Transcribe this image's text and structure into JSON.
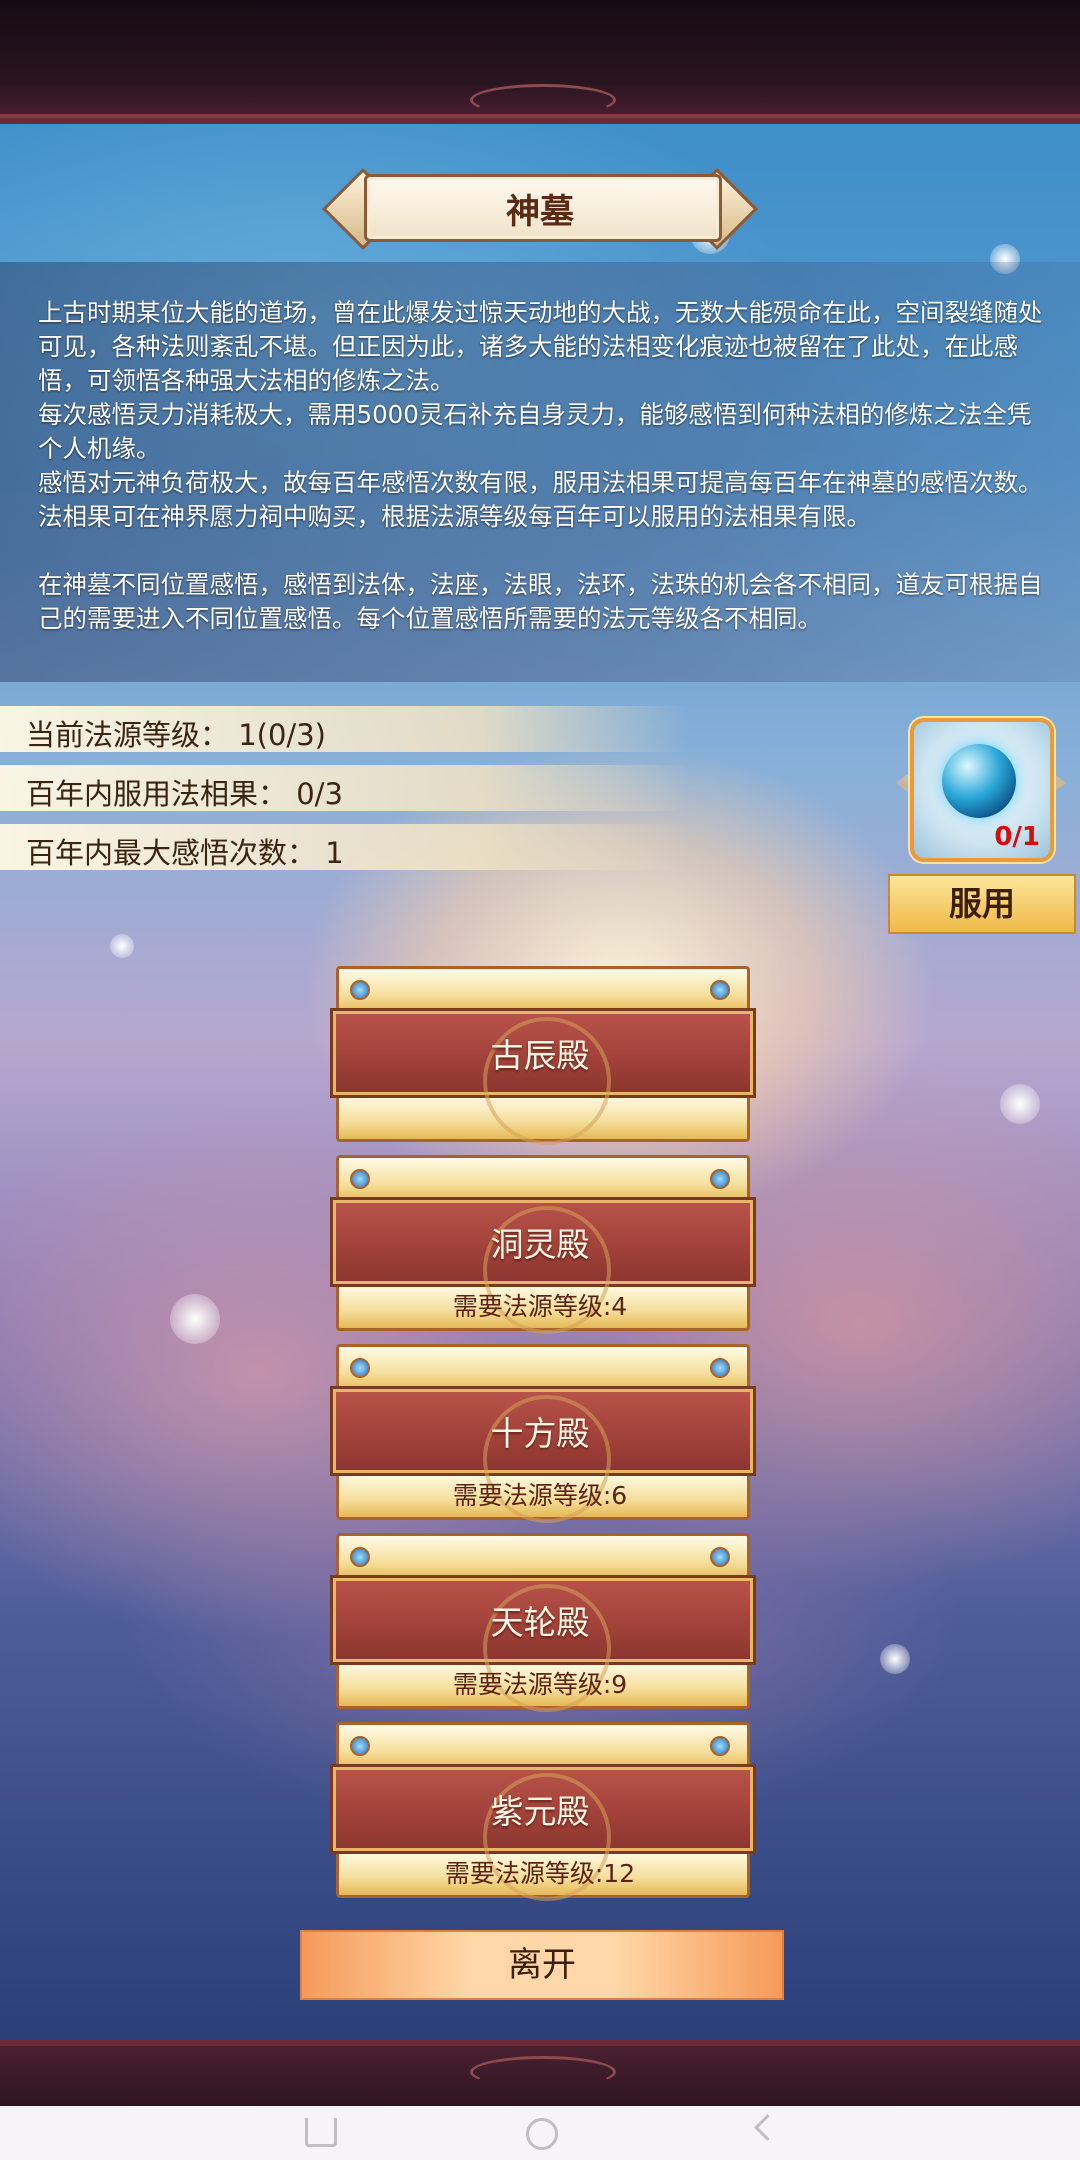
{
  "title": "神墓",
  "description": {
    "p1": "上古时期某位大能的道场，曾在此爆发过惊天动地的大战，无数大能殒命在此，空间裂缝随处可见，各种法则紊乱不堪。但正因为此，诸多大能的法相变化痕迹也被留在了此处，在此感悟，可领悟各种强大法相的修炼之法。",
    "p2": "每次感悟灵力消耗极大，需用5000灵石补充自身灵力，能够感悟到何种法相的修炼之法全凭个人机缘。",
    "p3": "感悟对元神负荷极大，故每百年感悟次数有限，服用法相果可提高每百年在神墓的感悟次数。法相果可在神界愿力祠中购买，根据法源等级每百年可以服用的法相果有限。",
    "p4": "在神墓不同位置感悟，感悟到法体，法座，法眼，法环，法珠的机会各不相同，道友可根据自己的需要进入不同位置感悟。每个位置感悟所需要的法元等级各不相同。"
  },
  "stats": {
    "source_level": "当前法源等级：  1(0/3)",
    "fruit_used": "百年内服用法相果：  0/3",
    "max_insight": "百年内最大感悟次数：  1"
  },
  "item": {
    "icon": "blue-orb-icon",
    "count": "0/1",
    "use_label": "服用"
  },
  "halls": [
    {
      "name": "古辰殿",
      "req": ""
    },
    {
      "name": "洞灵殿",
      "req": "需要法源等级:4"
    },
    {
      "name": "十方殿",
      "req": "需要法源等级:6"
    },
    {
      "name": "天轮殿",
      "req": "需要法源等级:9"
    },
    {
      "name": "紫元殿",
      "req": "需要法源等级:12"
    }
  ],
  "leave_label": "离开"
}
